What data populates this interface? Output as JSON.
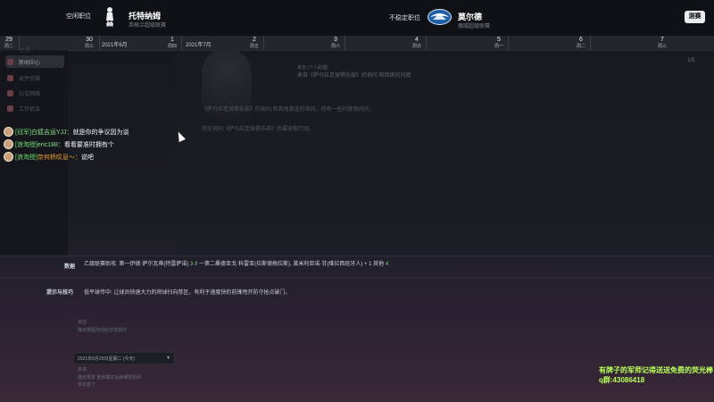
{
  "topbar": {
    "left_label": "空闲职位",
    "left_club_name": "托特纳姆",
    "left_club_sub": "英格兰超级联赛",
    "right_label": "不稳定职位",
    "right_club_name": "莫尔德",
    "right_club_sub": "挪威超级联赛",
    "continue_label": "测赛",
    "icons": {
      "left_badge": "cockerel-crest-icon",
      "right_badge": "wing-crest-icon"
    }
  },
  "calendar": {
    "days": [
      {
        "num": "29",
        "wd": "周二"
      },
      {
        "num": "30",
        "wd": "周三"
      },
      {
        "num": "1",
        "wd": "周四"
      },
      {
        "num": "2",
        "wd": "周五"
      },
      {
        "num": "3",
        "wd": "周六"
      },
      {
        "num": "4",
        "wd": "周日"
      },
      {
        "num": "5",
        "wd": "周一"
      },
      {
        "num": "6",
        "wd": "周二"
      },
      {
        "num": "7",
        "wd": "周三"
      }
    ],
    "month_labels": [
      "2021年6月",
      "2021年7月"
    ]
  },
  "sidebar": {
    "items": [
      {
        "label": "新闻中心",
        "active": true
      },
      {
        "label": "收件信箱",
        "active": false
      },
      {
        "label": "社交网络",
        "active": false
      },
      {
        "label": "工作机会",
        "active": false
      }
    ],
    "top_hint": "主页"
  },
  "message": {
    "from": "来自 (个人助理)",
    "subject": "来自《萨马拉足球俱乐部》的询问 和西奥的问题",
    "body_line1": "《萨马拉足球俱乐部》的询问 和其他事宜的询问，你有一些问题想问问。",
    "body_line2": "你在询问《萨马拉足球俱乐部》后要采取行动。",
    "scroll_hint": "1/5"
  },
  "chat": [
    {
      "tag": "[冠军]",
      "nick": "白狐吉运YJJ：",
      "text": "就是你的争议因为谈"
    },
    {
      "tag": "[浪淘授]",
      "nick": "eric188：",
      "text": "看看要准时拥有个"
    },
    {
      "tag": "[浪淘授]",
      "nick": "奈何桥叹息～：",
      "text": "说吧"
    }
  ],
  "info": {
    "stats_label": "数据",
    "stats_text_pre": "乙级联赛助攻: 第一伊德·萨尔瓦蒂(特雷萨诺) ",
    "stats_num1": "3",
    "stats_text_mid": " // 一第二桑德亚戈·科雷亚(拉斯德梅拉斯), 莱米利亚诺·甘(维拉西班牙人) + 1 其他 ",
    "stats_num2": "4",
    "tips_label": "提示与技巧",
    "tips_text": "低平球传中: 让球员快速大力的将球扫向禁区，有利于速度快的前锋甩开防守抢点破门。"
  },
  "lower": {
    "note1_title": "来自",
    "note1_text": "确定赛程改动给您发邮件",
    "dropdown_label": "2021年6月29日星期二 (今天)",
    "note2_title": "来自",
    "note2_line1": "确定赛季 重新确定后续期限后的",
    "note2_line2": "季初报了"
  },
  "overlay": {
    "line1": "有牌子的军师记得送送免费的荧光棒",
    "line2": "q群:43086418"
  },
  "colors": {
    "topbar_bg": "#0f1115",
    "continue_bg": "#e9ebee",
    "chat_tag": "#6fdc6f",
    "overlay_text": "#b9ff5a",
    "stats_green": "#7fd36b"
  }
}
